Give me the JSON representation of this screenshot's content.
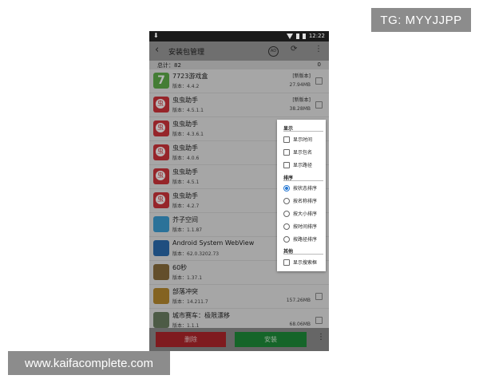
{
  "watermarks": {
    "top": "TG: MYYJJPP",
    "bottom": "www.kaifacomplete.com"
  },
  "status_bar": {
    "time": "12:22"
  },
  "app_bar": {
    "title": "安装包管理",
    "back_icon": "arrow-back-icon",
    "ad_icon": "AD",
    "refresh_icon": "refresh-icon",
    "more_icon": "more-vert-icon"
  },
  "summary": {
    "total_label": "总计：82",
    "right_value": "0"
  },
  "apps": [
    {
      "name": "7723游戏盒",
      "version": "版本：4.4.2",
      "tag": "[新版本]",
      "size": "27.94MB"
    },
    {
      "name": "虫虫助手",
      "version": "版本：4.5.1.1",
      "tag": "[新版本]",
      "size": "38.28MB"
    },
    {
      "name": "虫虫助手",
      "version": "版本：4.3.6.1",
      "tag": "",
      "size": ""
    },
    {
      "name": "虫虫助手",
      "version": "版本：4.0.6",
      "tag": "",
      "size": ""
    },
    {
      "name": "虫虫助手",
      "version": "版本：4.5.1",
      "tag": "",
      "size": ""
    },
    {
      "name": "虫虫助手",
      "version": "版本：4.2.7",
      "tag": "",
      "size": ""
    },
    {
      "name": "芥子空间",
      "version": "版本：1.1.87",
      "tag": "",
      "size": ""
    },
    {
      "name": "Android System WebView",
      "version": "版本：62.0.3202.73",
      "tag": "",
      "size": ""
    },
    {
      "name": "60秒",
      "version": "版本：1.37.1",
      "tag": "",
      "size": ""
    },
    {
      "name": "部落冲突",
      "version": "版本：14.211.7",
      "tag": "",
      "size": "157.26MB"
    },
    {
      "name": "城市赛车：极限漂移",
      "version": "版本：1.1.1",
      "tag": "",
      "size": "68.06MB"
    }
  ],
  "bottom_bar": {
    "delete_label": "删除",
    "install_label": "安装"
  },
  "menu": {
    "section_display": "显示",
    "display_options": [
      "显示时间",
      "显示包名",
      "显示路径"
    ],
    "section_sort": "排序",
    "sort_options": [
      "按状态排序",
      "按名称排序",
      "按大小排序",
      "按时间排序",
      "按路径排序"
    ],
    "selected_sort": "按状态排序",
    "section_other": "其他",
    "other_options": [
      "显示搜索框"
    ]
  },
  "colors": {
    "delete": "#b0262c",
    "install": "#1e8c3a",
    "radio_selected": "#2a7bd4"
  }
}
